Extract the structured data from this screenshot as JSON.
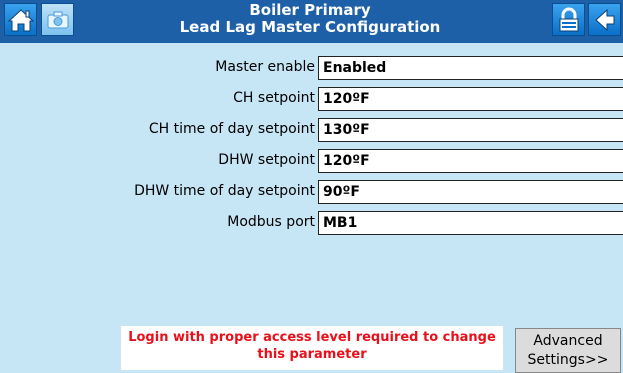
{
  "header": {
    "title_line1": "Boiler Primary",
    "title_line2": "Lead Lag Master Configuration",
    "icons": [
      "home-icon",
      "camera-icon",
      "lock-icon",
      "back-arrow-icon"
    ]
  },
  "fields": [
    {
      "label": "Master enable",
      "value": "Enabled"
    },
    {
      "label": "CH setpoint",
      "value": "120ºF"
    },
    {
      "label": "CH time of day setpoint",
      "value": "130ºF"
    },
    {
      "label": "DHW setpoint",
      "value": "120ºF"
    },
    {
      "label": "DHW time of day setpoint",
      "value": "90ºF"
    },
    {
      "label": "Modbus port",
      "value": "MB1"
    }
  ],
  "warning": "Login with proper access level required to change this parameter",
  "advanced_button": {
    "line1": "Advanced",
    "line2": "Settings>>"
  },
  "colors": {
    "header": "#1e60a8",
    "background": "#c6e5f5",
    "warning_text": "#e8101a"
  }
}
